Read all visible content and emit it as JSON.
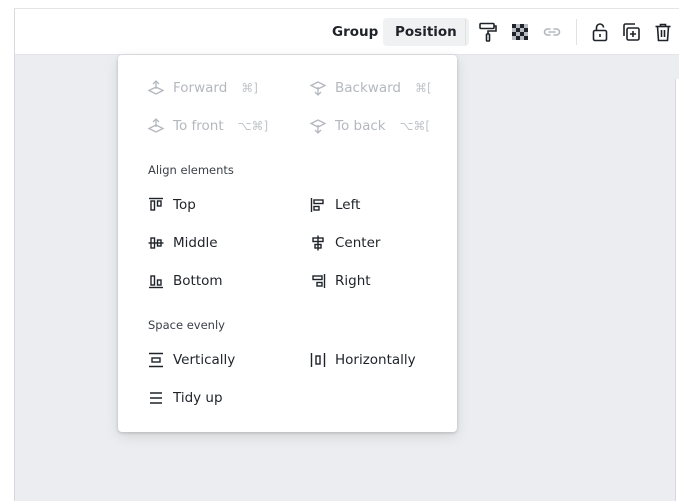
{
  "toolbar": {
    "group_label": "Group",
    "position_label": "Position",
    "icons": [
      "paint-roller-icon",
      "transparency-icon",
      "link-icon",
      "unlock-icon",
      "duplicate-icon",
      "trash-icon"
    ]
  },
  "menu": {
    "layer_items": [
      {
        "label": "Forward",
        "shortcut": "⌘]",
        "icon": "bring-forward-icon",
        "enabled": false
      },
      {
        "label": "Backward",
        "shortcut": "⌘[",
        "icon": "send-backward-icon",
        "enabled": false
      },
      {
        "label": "To front",
        "shortcut": "⌥⌘]",
        "icon": "bring-to-front-icon",
        "enabled": false
      },
      {
        "label": "To back",
        "shortcut": "⌥⌘[",
        "icon": "send-to-back-icon",
        "enabled": false
      }
    ],
    "align_title": "Align elements",
    "align_items": [
      {
        "label": "Top",
        "icon": "align-top-icon"
      },
      {
        "label": "Left",
        "icon": "align-left-icon"
      },
      {
        "label": "Middle",
        "icon": "align-middle-icon"
      },
      {
        "label": "Center",
        "icon": "align-center-icon"
      },
      {
        "label": "Bottom",
        "icon": "align-bottom-icon"
      },
      {
        "label": "Right",
        "icon": "align-right-icon"
      }
    ],
    "space_title": "Space evenly",
    "space_items": [
      {
        "label": "Vertically",
        "icon": "distribute-vertical-icon"
      },
      {
        "label": "Horizontally",
        "icon": "distribute-horizontal-icon"
      },
      {
        "label": "Tidy up",
        "icon": "tidy-up-icon"
      }
    ]
  },
  "colors": {
    "text": "#1f2329",
    "disabled_text": "#b4b8be",
    "canvas": "#ebedf0",
    "button_active_bg": "#f0f1f3"
  }
}
